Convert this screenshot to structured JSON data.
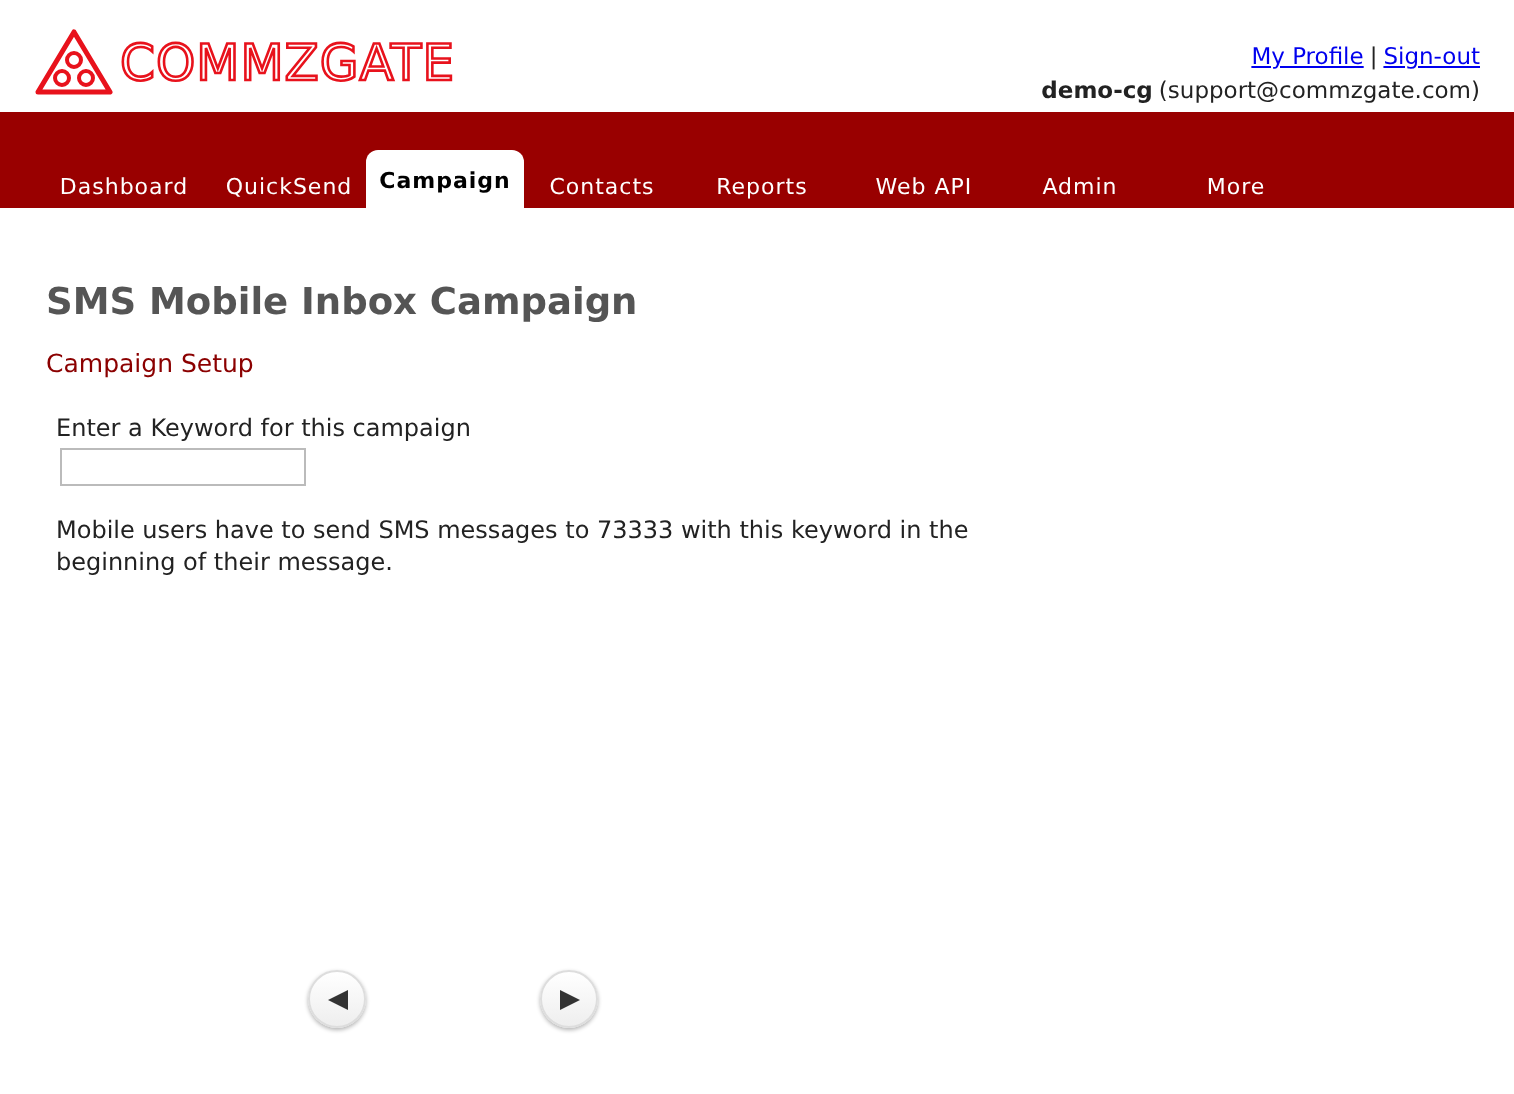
{
  "logo": {
    "text": "COMMZGATE"
  },
  "header_links": [
    "My Profile",
    "Sign-out"
  ],
  "header_separator": "|",
  "user": {
    "name": "demo-cg",
    "email": "(support@commzgate.com)"
  },
  "tabs": [
    {
      "label": "Dashboard",
      "selected": false
    },
    {
      "label": "QuickSend",
      "selected": false
    },
    {
      "label": "Campaign",
      "selected": true
    },
    {
      "label": "Contacts",
      "selected": false
    },
    {
      "label": "Reports",
      "selected": false
    },
    {
      "label": "Web API",
      "selected": false
    },
    {
      "label": "Admin",
      "selected": false
    },
    {
      "label": "More",
      "selected": false
    }
  ],
  "page_title": "SMS Mobile Inbox Campaign",
  "section_title": "Campaign Setup",
  "keyword_field": {
    "label": "Enter a Keyword for this campaign"
  },
  "help_text": "Mobile users have to send SMS messages to 73333 with this keyword in the beginning of their message.",
  "pager": [
    {
      "kind": "prev"
    },
    {
      "kind": "next"
    }
  ]
}
